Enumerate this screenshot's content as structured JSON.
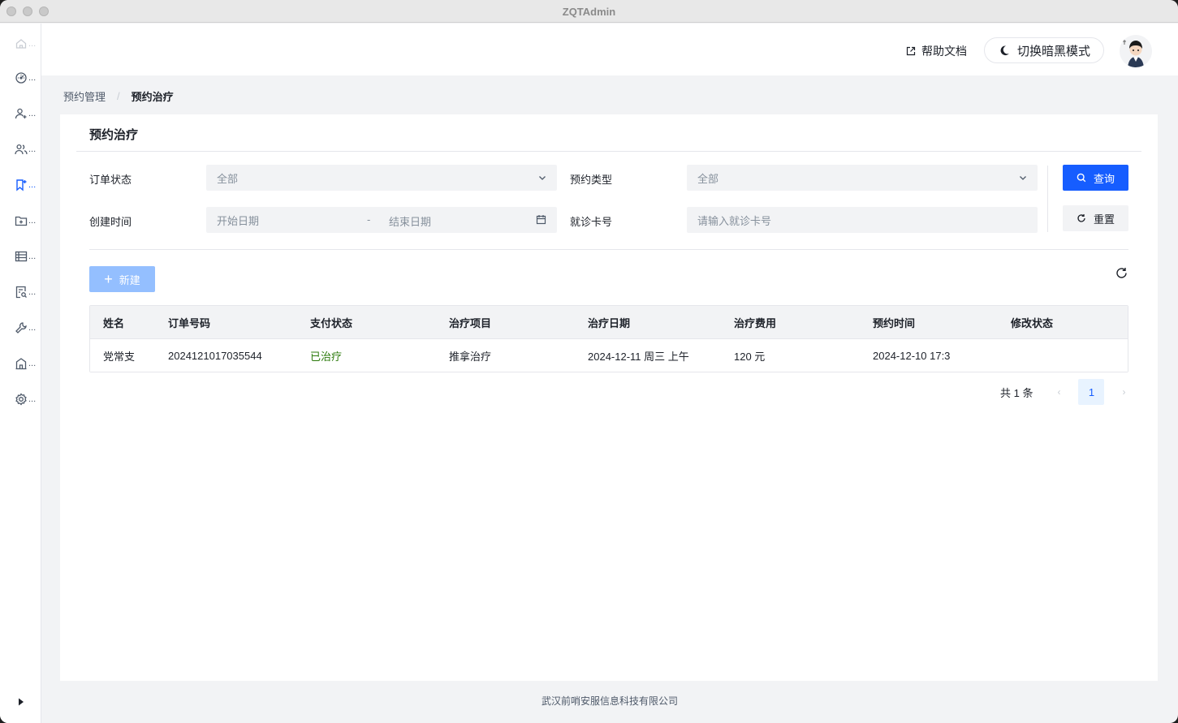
{
  "window": {
    "title": "ZQTAdmin"
  },
  "sidebar": {
    "items": [
      {
        "icon": "home-icon",
        "label": "...",
        "state": "disabled"
      },
      {
        "icon": "dashboard-icon",
        "label": "...",
        "state": "normal"
      },
      {
        "icon": "user-add-icon",
        "label": "...",
        "state": "normal"
      },
      {
        "icon": "user-group-icon",
        "label": "...",
        "state": "normal"
      },
      {
        "icon": "bookmark-icon",
        "label": "...",
        "state": "active"
      },
      {
        "icon": "folder-add-icon",
        "label": "...",
        "state": "normal"
      },
      {
        "icon": "table-icon",
        "label": "...",
        "state": "normal"
      },
      {
        "icon": "file-search-icon",
        "label": "...",
        "state": "normal"
      },
      {
        "icon": "tool-icon",
        "label": "...",
        "state": "normal"
      },
      {
        "icon": "building-icon",
        "label": "...",
        "state": "normal"
      },
      {
        "icon": "settings-icon",
        "label": "...",
        "state": "normal"
      }
    ],
    "colors": {
      "active": "#165dff",
      "normal": "#4e5969",
      "disabled": "#c9cdd4"
    }
  },
  "header": {
    "help_label": "帮助文档",
    "theme_label": "切换暗黑模式"
  },
  "breadcrumb": {
    "parent": "预约管理",
    "separator": "/",
    "current": "预约治疗"
  },
  "card": {
    "title": "预约治疗"
  },
  "filters": {
    "order_status": {
      "label": "订单状态",
      "value": "全部"
    },
    "appointment_type": {
      "label": "预约类型",
      "value": "全部"
    },
    "created_time": {
      "label": "创建时间",
      "start_placeholder": "开始日期",
      "separator": "-",
      "end_placeholder": "结束日期"
    },
    "card_number": {
      "label": "就诊卡号",
      "placeholder": "请输入就诊卡号"
    },
    "query_label": "查询",
    "reset_label": "重置"
  },
  "toolbar": {
    "new_label": "新建"
  },
  "table": {
    "columns": [
      "姓名",
      "订单号码",
      "支付状态",
      "治疗项目",
      "治疗日期",
      "治疗费用",
      "预约时间",
      "修改状态"
    ],
    "rows": [
      [
        "党常支",
        "2024121017035544",
        "已治疗",
        "推拿治疗",
        "2024-12-11 周三 上午",
        "120 元",
        "2024-12-10 17:3",
        ""
      ]
    ],
    "status_color": "#2b7a0b"
  },
  "pagination": {
    "total_label": "共 1 条",
    "current_page": "1",
    "prev": "‹",
    "next": "›"
  },
  "footer": {
    "text": "武汉前哨安服信息科技有限公司"
  },
  "colors": {
    "primary": "#165dff",
    "primary_disabled": "#94bfff",
    "page_bg": "#f2f3f5"
  }
}
